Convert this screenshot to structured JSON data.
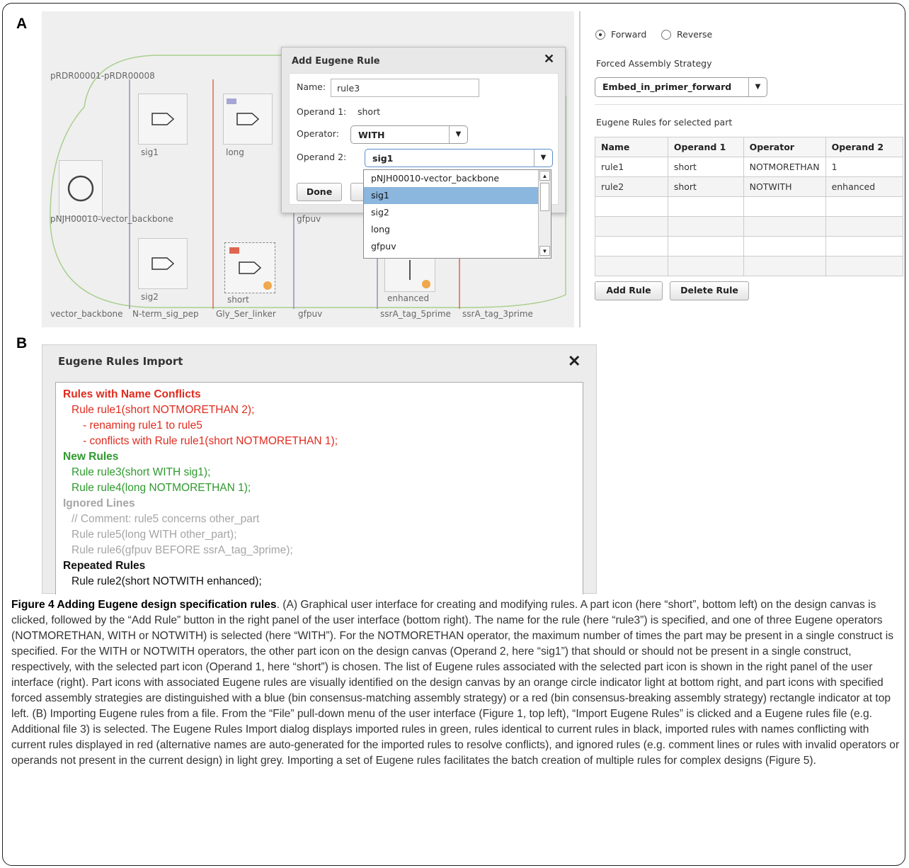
{
  "panel_a": {
    "letter": "A",
    "canvas": {
      "labels": {
        "construct": "pRDR00001-pRDR00008",
        "backbone_part": "pNJH00010-vector_backbone",
        "sig1": "sig1",
        "long": "long",
        "sig2": "sig2",
        "short": "short",
        "gfpuv_mid": "gfpuv",
        "enhanced": "enhanced"
      },
      "bins": [
        "vector_backbone",
        "N-term_sig_pep",
        "Gly_Ser_linker",
        "gfpuv",
        "ssrA_tag_5prime",
        "ssrA_tag_3prime"
      ]
    },
    "dialog": {
      "title": "Add Eugene Rule",
      "name_label": "Name:",
      "name_value": "rule3",
      "operand1_label": "Operand 1:",
      "operand1_value": "short",
      "operator_label": "Operator:",
      "operator_value": "WITH",
      "operand2_label": "Operand 2:",
      "operand2_value": "sig1",
      "done_label": "Done",
      "dropdown_options": [
        "pNJH00010-vector_backbone",
        "sig1",
        "sig2",
        "long",
        "gfpuv"
      ],
      "dropdown_selected": "sig1"
    },
    "right_panel": {
      "forward_label": "Forward",
      "reverse_label": "Reverse",
      "strategy_label": "Forced Assembly Strategy",
      "strategy_value": "Embed_in_primer_forward",
      "rules_label": "Eugene Rules for selected part",
      "table_headers": [
        "Name",
        "Operand 1",
        "Operator",
        "Operand 2"
      ],
      "table_rows": [
        [
          "rule1",
          "short",
          "NOTMORETHAN",
          "1"
        ],
        [
          "rule2",
          "short",
          "NOTWITH",
          "enhanced"
        ]
      ],
      "add_rule_label": "Add Rule",
      "delete_rule_label": "Delete Rule"
    }
  },
  "panel_b": {
    "letter": "B",
    "title": "Eugene Rules Import",
    "lines": [
      {
        "text": "Rules with Name Conflicts",
        "style": "red",
        "heading": true,
        "indent": 0
      },
      {
        "text": "Rule rule1(short NOTMORETHAN 2);",
        "style": "red",
        "heading": false,
        "indent": 1
      },
      {
        "text": "- renaming rule1 to rule5",
        "style": "red",
        "heading": false,
        "indent": 2
      },
      {
        "text": "- conflicts with Rule rule1(short NOTMORETHAN 1);",
        "style": "red",
        "heading": false,
        "indent": 2
      },
      {
        "text": "New Rules",
        "style": "green",
        "heading": true,
        "indent": 0
      },
      {
        "text": "Rule rule3(short WITH sig1);",
        "style": "green",
        "heading": false,
        "indent": 1
      },
      {
        "text": "Rule rule4(long NOTMORETHAN 1);",
        "style": "green",
        "heading": false,
        "indent": 1
      },
      {
        "text": "Ignored Lines",
        "style": "grey",
        "heading": true,
        "indent": 0
      },
      {
        "text": "// Comment: rule5 concerns other_part",
        "style": "grey",
        "heading": false,
        "indent": 1
      },
      {
        "text": "Rule rule5(long WITH other_part);",
        "style": "grey",
        "heading": false,
        "indent": 1
      },
      {
        "text": "Rule rule6(gfpuv BEFORE ssrA_tag_3prime);",
        "style": "grey",
        "heading": false,
        "indent": 1
      },
      {
        "text": "Repeated Rules",
        "style": "black",
        "heading": true,
        "indent": 0
      },
      {
        "text": "Rule rule2(short NOTWITH enhanced);",
        "style": "black",
        "heading": false,
        "indent": 1
      }
    ]
  },
  "caption": {
    "title": "Figure 4 Adding Eugene design specification rules",
    "body": ". (A) Graphical user interface for creating and modifying rules. A part icon (here “short”, bottom left) on the design canvas is clicked, followed by the “Add Rule” button in the right panel of the user interface (bottom right). The name for the rule (here “rule3”) is specified, and one of three Eugene operators (NOTMORETHAN, WITH or NOTWITH) is selected (here “WITH”). For the NOTMORETHAN operator, the maximum number of times the part may be present in a single construct is specified. For the WITH or NOTWITH operators, the other part icon on the design canvas (Operand 2, here “sig1”) that should or should not be present in a single construct, respectively, with the selected part icon (Operand 1, here “short”) is chosen. The list of Eugene rules associated with the selected part icon is shown in the right panel of the user interface (right). Part icons with associated Eugene rules are visually identified on the design canvas by an orange circle indicator light at bottom right, and part icons with specified forced assembly strategies are distinguished with a blue (bin consensus-matching assembly strategy) or a red (bin consensus-breaking assembly strategy) rectangle indicator at top left. (B) Importing Eugene rules from a file. From the “File” pull-down menu of the user interface (Figure 1, top left), “Import Eugene Rules” is clicked and a Eugene rules file (e.g. Additional file 3) is selected. The Eugene Rules Import dialog displays imported rules in green, rules identical to current rules in black, imported rules with names conflicting with current rules displayed in red (alternative names are auto-generated for the imported rules to resolve conflicts), and ignored rules (e.g. comment lines or rules with invalid operators or operands not present in the current design) in light grey. Importing a set of Eugene rules facilitates the batch creation of multiple rules for complex designs (Figure 5)."
  },
  "colors": {
    "conflict_red": "#e02b1e",
    "new_green": "#2e9a2e",
    "ignored_grey": "#a5a5a5",
    "bin_purple": "#9b8cc0",
    "bin_red": "#e0654f",
    "indicator_orange": "#f0a84c",
    "indicator_blue": "#a6a6d6",
    "selection_blue": "#8bb6de",
    "construct_green": "#a9cf8e"
  }
}
